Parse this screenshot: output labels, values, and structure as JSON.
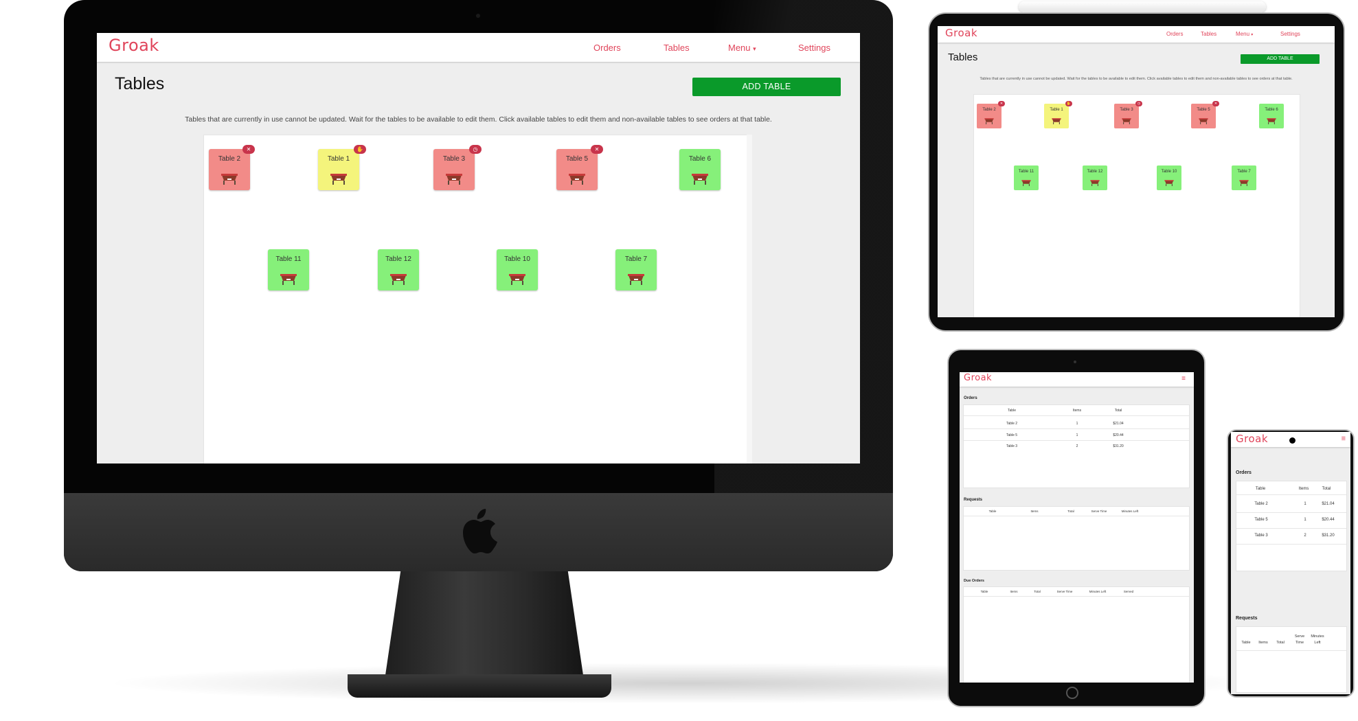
{
  "app": {
    "logo": "Groak",
    "nav": {
      "orders": "Orders",
      "tables": "Tables",
      "menu": "Menu",
      "menu_caret": "▾",
      "settings": "Settings"
    },
    "accent_color": "#e0445a",
    "burger_icon": "≡"
  },
  "tables_page": {
    "title": "Tables",
    "add_button": "ADD TABLE",
    "info": "Tables that are currently in use cannot be updated. Wait for the tables to be available to edit them. Click available tables to edit them and non-available tables to see orders at that table.",
    "status_colors": {
      "occupied": "#f28b88",
      "requesting": "#f4f47c",
      "available": "#86f07a"
    },
    "tables": [
      {
        "name": "Table 2",
        "status": "occupied",
        "badge_icon": "dining-icon"
      },
      {
        "name": "Table 1",
        "status": "requesting",
        "badge_icon": "hand-icon"
      },
      {
        "name": "Table 3",
        "status": "occupied",
        "badge_icon": "clock-icon"
      },
      {
        "name": "Table 5",
        "status": "occupied",
        "badge_icon": "dining-icon"
      },
      {
        "name": "Table 6",
        "status": "available"
      },
      {
        "name": "Table 11",
        "status": "available"
      },
      {
        "name": "Table 12",
        "status": "available"
      },
      {
        "name": "Table 10",
        "status": "available"
      },
      {
        "name": "Table 7",
        "status": "available"
      }
    ]
  },
  "dashboard": {
    "orders_title": "Orders",
    "orders_headers": [
      "Table",
      "Items",
      "Total"
    ],
    "orders_rows": [
      {
        "table": "Table 2",
        "items": "1",
        "total": "$21.04"
      },
      {
        "table": "Table 5",
        "items": "1",
        "total": "$20.44"
      },
      {
        "table": "Table 3",
        "items": "2",
        "total": "$31.20"
      }
    ],
    "requests_title": "Requests",
    "requests_headers": [
      "Table",
      "Items",
      "Total",
      "Serve Time",
      "Minutes Left"
    ],
    "due_title": "Due Orders",
    "due_headers": [
      "Table",
      "Items",
      "Total",
      "Serve Time",
      "Minutes Left",
      "Served"
    ]
  }
}
